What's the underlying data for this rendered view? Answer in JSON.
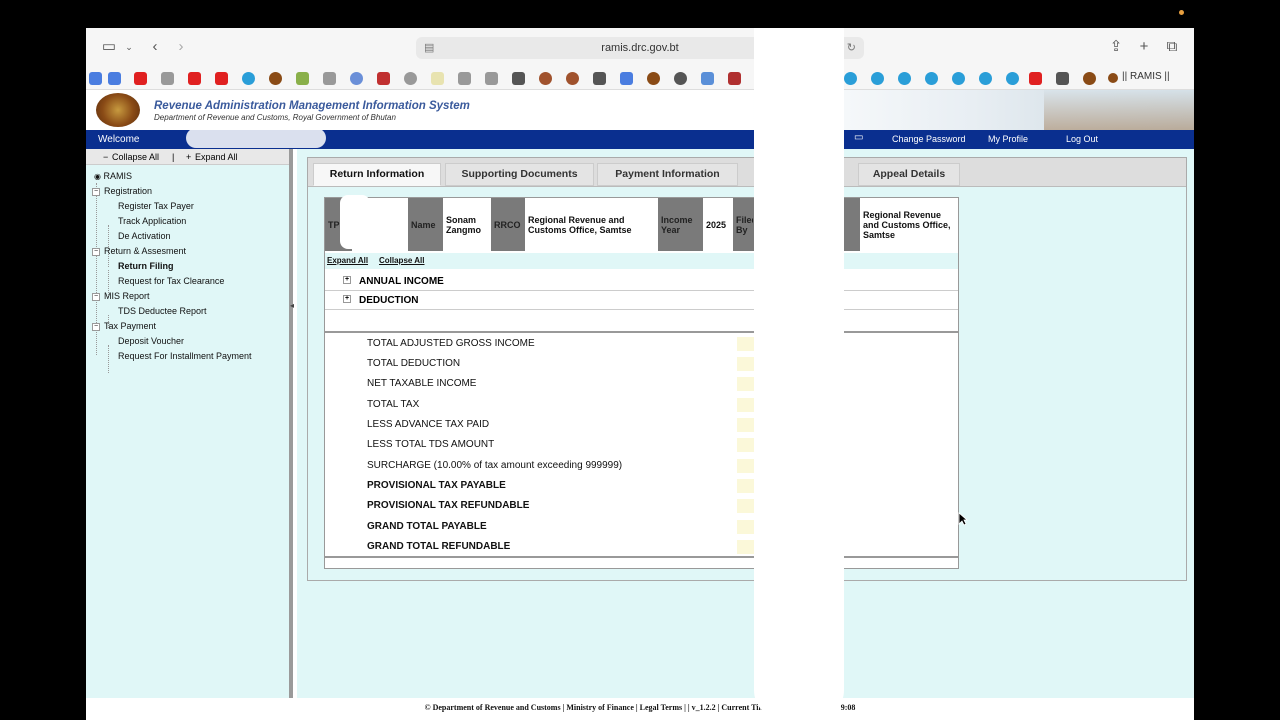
{
  "browser": {
    "url": "ramis.drc.gov.bt",
    "tab_title": "|| RAMIS ||"
  },
  "site": {
    "title": "Revenue Administration Management Information System",
    "subtitle": "Department of Revenue and Customs, Royal Government of Bhutan",
    "welcome": "Welcome",
    "nav": [
      "Change Password",
      "My Profile",
      "Log Out"
    ]
  },
  "sidebar": {
    "collapse_all": "Collapse All",
    "separator": "|",
    "expand_all": "Expand All",
    "root": "RAMIS",
    "groups": [
      {
        "label": "Registration",
        "items": [
          "Register Tax Payer",
          "Track Application",
          "De Activation"
        ]
      },
      {
        "label": "Return & Assesment",
        "items": [
          "Return Filing",
          "Request for Tax Clearance"
        ]
      },
      {
        "label": "MIS Report",
        "items": [
          "TDS Deductee Report"
        ]
      },
      {
        "label": "Tax Payment",
        "items": [
          "Deposit Voucher",
          "Request For Installment Payment"
        ]
      }
    ]
  },
  "tabs": [
    "Return Information",
    "Supporting Documents",
    "Payment Information",
    "Appeal Details"
  ],
  "return_header": {
    "tpn_label": "TPN",
    "name_label": "Name",
    "name_value": "Sonam Zangmo",
    "rrco_label": "RRCO",
    "rrco_value": "Regional Revenue and Customs Office, Samtse",
    "income_year_label": "Income Year",
    "income_year_value": "2025",
    "filed_by_label": "Filed By",
    "office_value": "Regional Revenue and Customs Office, Samtse"
  },
  "table_controls": {
    "expand_all": "Expand All",
    "collapse_all": "Collapse All"
  },
  "sections": [
    "ANNUAL INCOME",
    "DEDUCTION"
  ],
  "summary": [
    {
      "label": "TOTAL ADJUSTED GROSS INCOME",
      "bold": false
    },
    {
      "label": "TOTAL DEDUCTION",
      "bold": false
    },
    {
      "label": "NET TAXABLE INCOME",
      "bold": false
    },
    {
      "label": "TOTAL TAX",
      "bold": false
    },
    {
      "label": "LESS ADVANCE TAX PAID",
      "bold": false
    },
    {
      "label": "LESS TOTAL TDS AMOUNT",
      "bold": false
    },
    {
      "label": "SURCHARGE (10.00% of tax amount exceeding 999999)",
      "bold": false
    },
    {
      "label": "PROVISIONAL TAX PAYABLE",
      "bold": true
    },
    {
      "label": "PROVISIONAL TAX REFUNDABLE",
      "bold": true
    },
    {
      "label": "GRAND TOTAL PAYABLE",
      "bold": true
    },
    {
      "label": "GRAND TOTAL REFUNDABLE",
      "bold": true
    }
  ],
  "footer": "© Department of Revenue and Customs | Ministry of Finance | Legal Terms | | v_1.2.2 | Current Time",
  "footer_time": "9:08"
}
